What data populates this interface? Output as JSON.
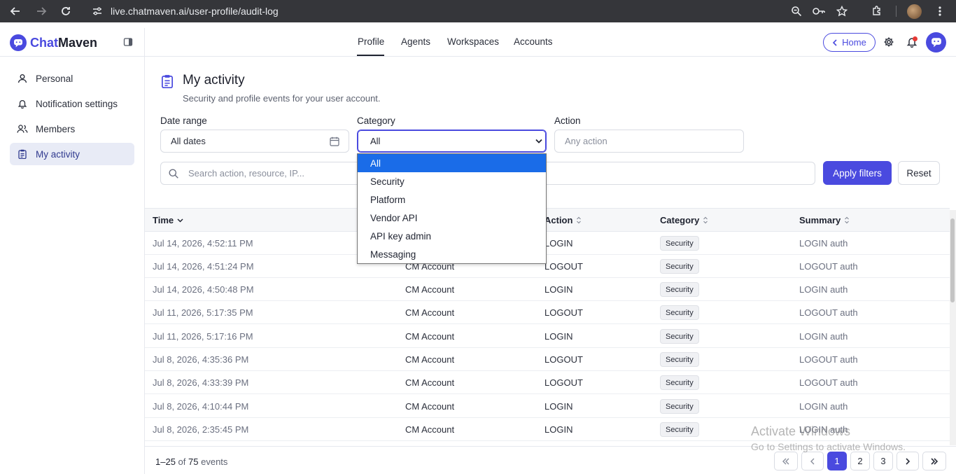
{
  "browser": {
    "url": "live.chatmaven.ai/user-profile/audit-log"
  },
  "app": {
    "logo_prefix": "Chat",
    "logo_suffix": "Maven",
    "accent": "#4a4adf"
  },
  "topnav": {
    "tabs": [
      {
        "label": "Profile",
        "active": true
      },
      {
        "label": "Agents",
        "active": false
      },
      {
        "label": "Workspaces",
        "active": false
      },
      {
        "label": "Accounts",
        "active": false
      }
    ],
    "home_label": "Home"
  },
  "sidebar": {
    "items": [
      {
        "label": "Personal",
        "icon": "user-icon",
        "active": false
      },
      {
        "label": "Notification settings",
        "icon": "bell-icon",
        "active": false
      },
      {
        "label": "Members",
        "icon": "users-icon",
        "active": false
      },
      {
        "label": "My activity",
        "icon": "clipboard-icon",
        "active": true
      }
    ]
  },
  "page": {
    "title": "My activity",
    "subtitle": "Security and profile events for your user account."
  },
  "filters": {
    "date_range_label": "Date range",
    "date_range_value": "All dates",
    "category_label": "Category",
    "category_value": "All",
    "action_label": "Action",
    "action_placeholder": "Any action",
    "search_placeholder": "Search action, resource, IP...",
    "apply_label": "Apply filters",
    "reset_label": "Reset"
  },
  "category_dropdown": {
    "options": [
      "All",
      "Security",
      "Platform",
      "Vendor API",
      "API key admin",
      "Messaging"
    ],
    "selected": "All"
  },
  "table": {
    "headers": {
      "time": "Time",
      "action": "Action",
      "category": "Category",
      "summary": "Summary"
    },
    "rows": [
      {
        "time": "Jul 14, 2026, 4:52:11 PM",
        "resource": "",
        "action": "LOGIN",
        "category": "Security",
        "summary": "LOGIN auth"
      },
      {
        "time": "Jul 14, 2026, 4:51:24 PM",
        "resource": "CM Account",
        "action": "LOGOUT",
        "category": "Security",
        "summary": "LOGOUT auth"
      },
      {
        "time": "Jul 14, 2026, 4:50:48 PM",
        "resource": "CM Account",
        "action": "LOGIN",
        "category": "Security",
        "summary": "LOGIN auth"
      },
      {
        "time": "Jul 11, 2026, 5:17:35 PM",
        "resource": "CM Account",
        "action": "LOGOUT",
        "category": "Security",
        "summary": "LOGOUT auth"
      },
      {
        "time": "Jul 11, 2026, 5:17:16 PM",
        "resource": "CM Account",
        "action": "LOGIN",
        "category": "Security",
        "summary": "LOGIN auth"
      },
      {
        "time": "Jul 8, 2026, 4:35:36 PM",
        "resource": "CM Account",
        "action": "LOGOUT",
        "category": "Security",
        "summary": "LOGOUT auth"
      },
      {
        "time": "Jul 8, 2026, 4:33:39 PM",
        "resource": "CM Account",
        "action": "LOGOUT",
        "category": "Security",
        "summary": "LOGOUT auth"
      },
      {
        "time": "Jul 8, 2026, 4:10:44 PM",
        "resource": "CM Account",
        "action": "LOGIN",
        "category": "Security",
        "summary": "LOGIN auth"
      },
      {
        "time": "Jul 8, 2026, 2:35:45 PM",
        "resource": "CM Account",
        "action": "LOGIN",
        "category": "Security",
        "summary": "LOGIN auth"
      }
    ]
  },
  "footer": {
    "range": "1–25",
    "of_word": "of",
    "total": "75",
    "unit": "events",
    "pages": [
      "1",
      "2",
      "3"
    ],
    "current_page": "1"
  },
  "watermark": {
    "line1": "Activate Windows",
    "line2": "Go to Settings to activate Windows."
  }
}
